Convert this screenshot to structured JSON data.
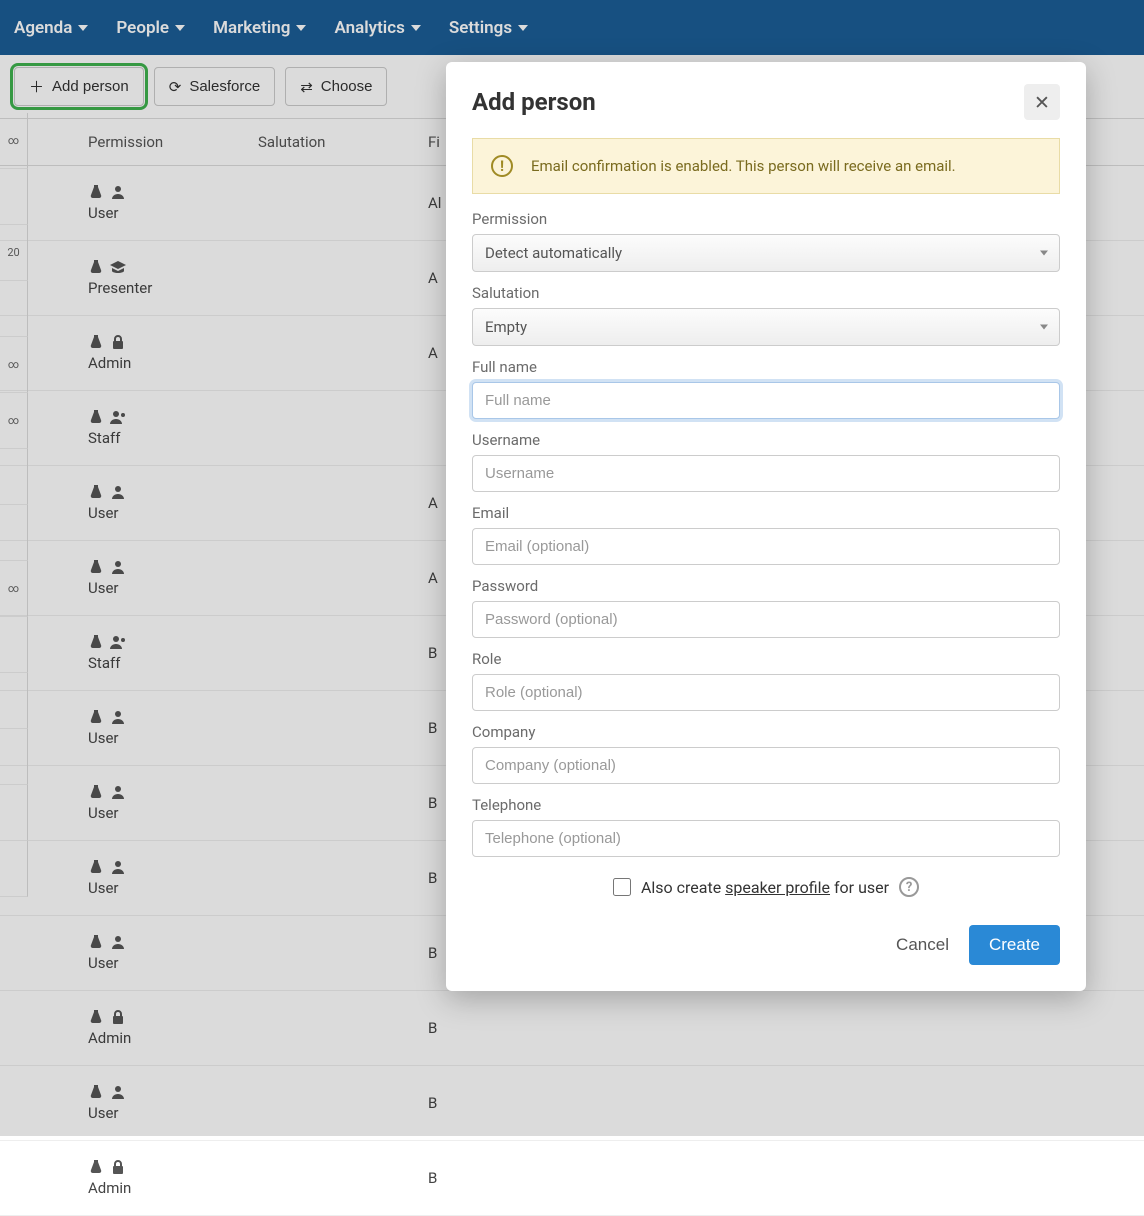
{
  "nav": [
    {
      "label": "Agenda"
    },
    {
      "label": "People"
    },
    {
      "label": "Marketing"
    },
    {
      "label": "Analytics"
    },
    {
      "label": "Settings"
    }
  ],
  "toolbar": {
    "add_person": "Add person",
    "salesforce": "Salesforce",
    "choose": "Choose"
  },
  "table": {
    "headers": {
      "permission": "Permission",
      "salutation": "Salutation",
      "first": "Fi"
    },
    "rows": [
      {
        "icon2": "user",
        "role": "User",
        "first": "Al"
      },
      {
        "icon2": "grad",
        "role": "Presenter",
        "first": "A"
      },
      {
        "icon2": "lock",
        "role": "Admin",
        "first": "A"
      },
      {
        "icon2": "staff",
        "role": "Staff",
        "first": ""
      },
      {
        "icon2": "user",
        "role": "User",
        "first": "A"
      },
      {
        "icon2": "user",
        "role": "User",
        "first": "A"
      },
      {
        "icon2": "staff",
        "role": "Staff",
        "first": "B"
      },
      {
        "icon2": "user",
        "role": "User",
        "first": "B"
      },
      {
        "icon2": "user",
        "role": "User",
        "first": "B"
      },
      {
        "icon2": "user",
        "role": "User",
        "first": "B"
      },
      {
        "icon2": "user",
        "role": "User",
        "first": "B"
      },
      {
        "icon2": "lock",
        "role": "Admin",
        "first": "B"
      },
      {
        "icon2": "user",
        "role": "User",
        "first": "B"
      },
      {
        "icon2": "lock",
        "role": "Admin",
        "first": "B"
      }
    ]
  },
  "gutter": [
    "∞",
    "",
    "20",
    "",
    "∞",
    "∞",
    "",
    "",
    "∞",
    "",
    "",
    "",
    "",
    ""
  ],
  "modal": {
    "title": "Add person",
    "alert": "Email confirmation is enabled. This person will receive an email.",
    "labels": {
      "permission": "Permission",
      "salutation": "Salutation",
      "fullname": "Full name",
      "username": "Username",
      "email": "Email",
      "password": "Password",
      "role": "Role",
      "company": "Company",
      "telephone": "Telephone"
    },
    "values": {
      "permission": "Detect automatically",
      "salutation": "Empty"
    },
    "placeholders": {
      "fullname": "Full name",
      "username": "Username",
      "email": "Email (optional)",
      "password": "Password (optional)",
      "role": "Role (optional)",
      "company": "Company (optional)",
      "telephone": "Telephone (optional)"
    },
    "checkbox_pre": "Also create ",
    "checkbox_link": "speaker profile",
    "checkbox_post": " for user",
    "cancel": "Cancel",
    "create": "Create"
  }
}
